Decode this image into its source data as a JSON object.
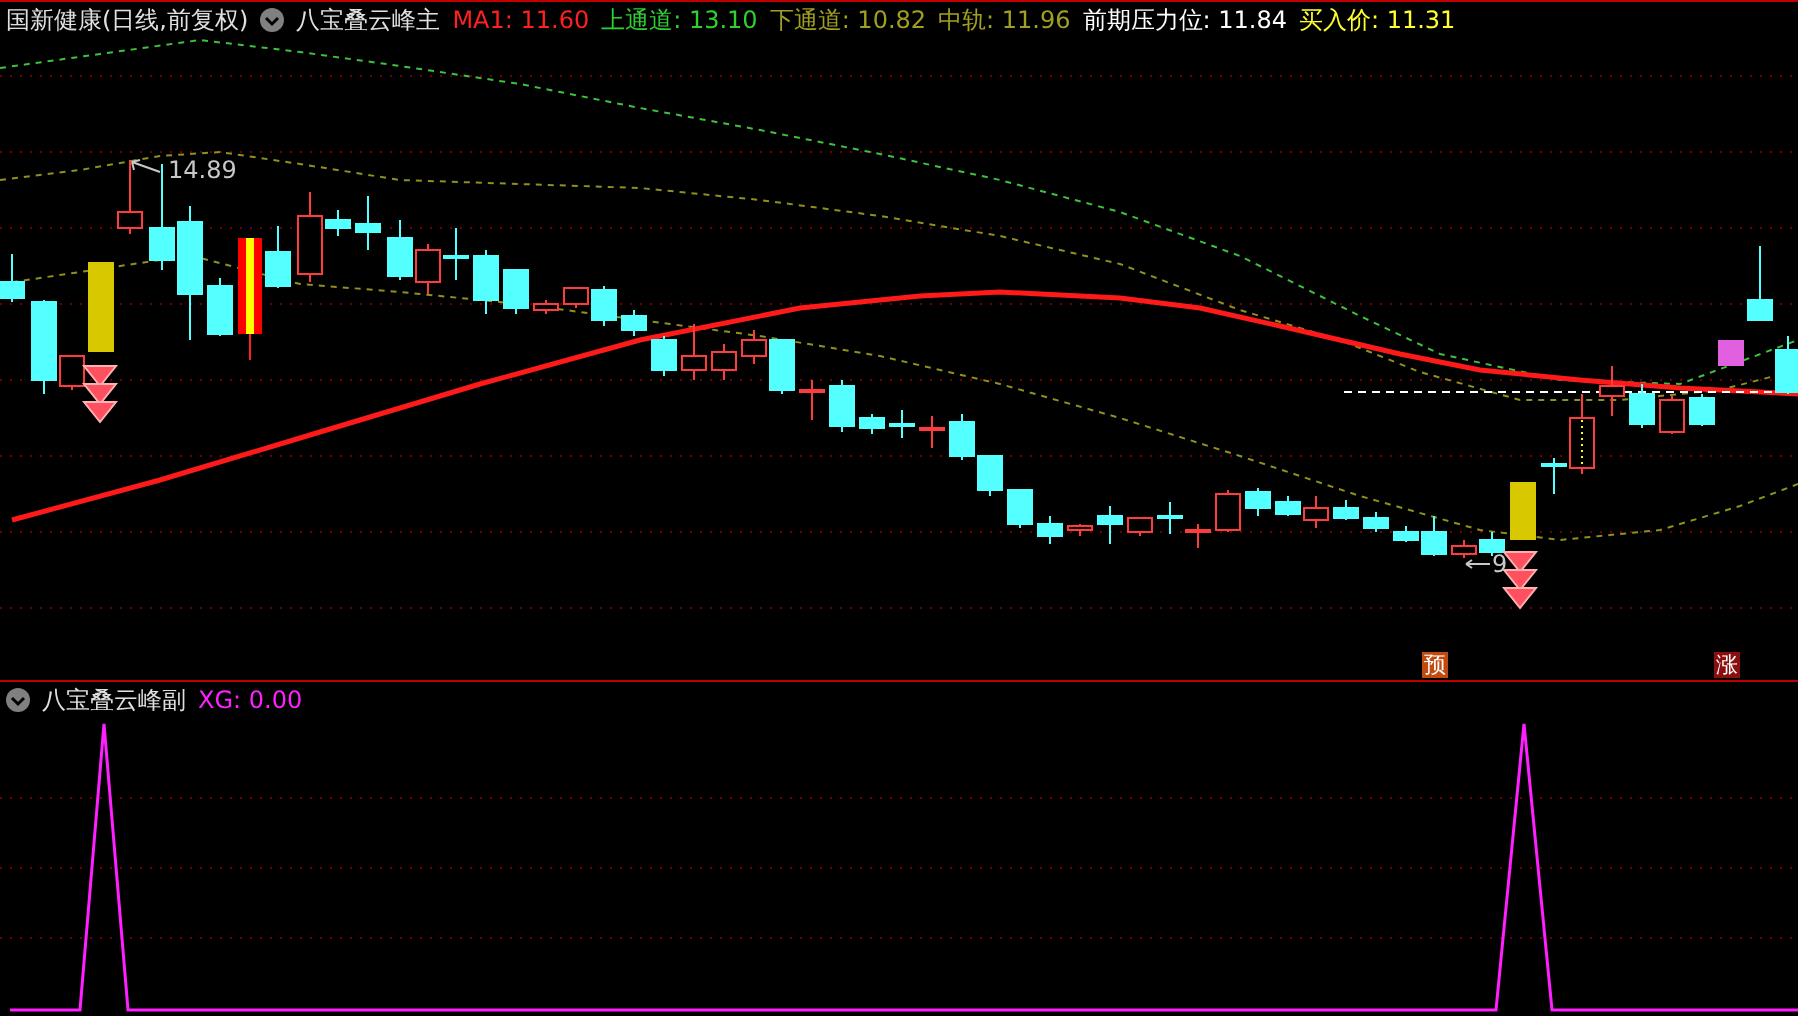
{
  "main_panel": {
    "title": "国新健康(日线,前复权)",
    "indicator": "八宝叠云峰主",
    "values": [
      {
        "text": "MA1: 11.60",
        "color": "#ff2020"
      },
      {
        "text": "上通道: 13.10",
        "color": "#30d030"
      },
      {
        "text": "下通道: 10.82",
        "color": "#a0a020"
      },
      {
        "text": "中轨: 11.96",
        "color": "#a0a020"
      },
      {
        "text": "前期压力位: 11.84",
        "color": "#ffffff"
      },
      {
        "text": "买入价: 11.31",
        "color": "#ffff30"
      }
    ],
    "high_label": "14.89",
    "low_label": "9",
    "signals": [
      {
        "text": "预",
        "color": "#c04a10"
      },
      {
        "text": "涨",
        "color": "#8a1010"
      }
    ]
  },
  "sub_panel": {
    "indicator": "八宝叠云峰副",
    "value": "XG: 0.00"
  }
}
